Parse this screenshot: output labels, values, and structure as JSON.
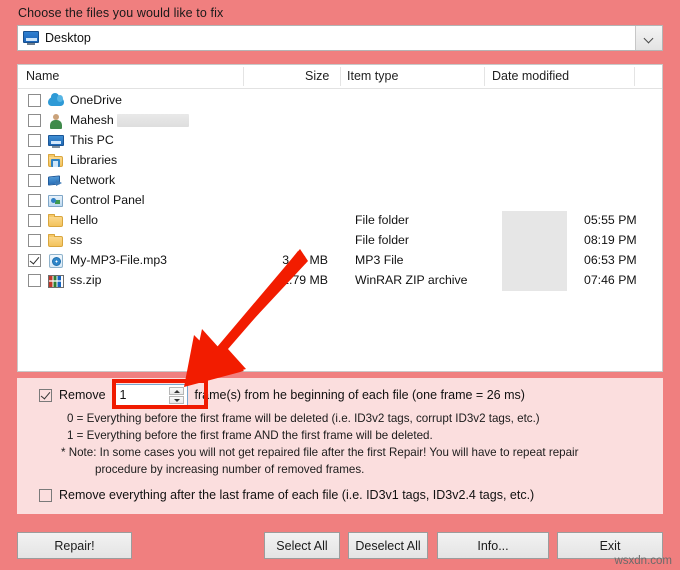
{
  "header": {
    "prompt": "Choose the files you would like to fix"
  },
  "path_combo": {
    "value": "Desktop",
    "icon": "monitor-icon",
    "dropdown_icon": "chevron-down-icon"
  },
  "file_list": {
    "columns": [
      "Name",
      "Size",
      "Item type",
      "Date modified"
    ],
    "rows": [
      {
        "name": "OneDrive",
        "icon": "onedrive-cloud-icon",
        "checked": false,
        "size": "",
        "type": "",
        "date_redacted": false,
        "time": "",
        "name_redacted": false
      },
      {
        "name": "Mahesh",
        "icon": "user-account-icon",
        "checked": false,
        "size": "",
        "type": "",
        "date_redacted": false,
        "time": "",
        "name_redacted": true
      },
      {
        "name": "This PC",
        "icon": "this-pc-icon",
        "checked": false,
        "size": "",
        "type": "",
        "date_redacted": false,
        "time": "",
        "name_redacted": false
      },
      {
        "name": "Libraries",
        "icon": "libraries-folder-icon",
        "checked": false,
        "size": "",
        "type": "",
        "date_redacted": false,
        "time": "",
        "name_redacted": false
      },
      {
        "name": "Network",
        "icon": "network-icon",
        "checked": false,
        "size": "",
        "type": "",
        "date_redacted": false,
        "time": "",
        "name_redacted": false
      },
      {
        "name": "Control Panel",
        "icon": "control-panel-icon",
        "checked": false,
        "size": "",
        "type": "",
        "date_redacted": false,
        "time": "",
        "name_redacted": false
      },
      {
        "name": "Hello",
        "icon": "folder-icon",
        "checked": false,
        "size": "",
        "type": "File folder",
        "date_redacted": true,
        "time": "05:55 PM",
        "name_redacted": false
      },
      {
        "name": "ss",
        "icon": "folder-icon",
        "checked": false,
        "size": "",
        "type": "File folder",
        "date_redacted": true,
        "time": "08:19 PM",
        "name_redacted": false
      },
      {
        "name": "My-MP3-File.mp3",
        "icon": "mp3-file-icon",
        "checked": true,
        "size": "3.62 MB",
        "type": "MP3 File",
        "date_redacted": true,
        "time": "06:53 PM",
        "name_redacted": false
      },
      {
        "name": "ss.zip",
        "icon": "winrar-zip-icon",
        "checked": false,
        "size": "2.79 MB",
        "type": "WinRAR ZIP archive",
        "date_redacted": true,
        "time": "07:46 PM",
        "name_redacted": false
      }
    ]
  },
  "options": {
    "remove_frames_checked": true,
    "remove_frames_prefix": "Remove",
    "frames_value": "1",
    "remove_frames_suffix": "frame(s) from he beginning of each file (one frame = 26 ms)",
    "notes": [
      "0 = Everything before the first frame will be deleted (i.e. ID3v2 tags, corrupt ID3v2 tags, etc.)",
      "1 = Everything before the first frame AND the first frame will be deleted.",
      "* Note: In some cases you will not get repaired file after the first Repair! You will have to repeat repair",
      "procedure by increasing number of removed frames."
    ],
    "remove_last_checked": false,
    "remove_last_label": "Remove everything after the last frame of each file (i.e. ID3v1 tags, ID3v2.4 tags, etc.)"
  },
  "buttons": {
    "repair": "Repair!",
    "select_all": "Select All",
    "deselect_all": "Deselect All",
    "info": "Info...",
    "exit": "Exit"
  },
  "annotation": {
    "arrow_icon": "red-arrow-icon",
    "arrow_color": "#f01a00",
    "highlight_color": "#f01a00"
  },
  "watermark": "wsxdn.com",
  "colors": {
    "background": "#f07f7f",
    "panel": "#fbdede",
    "list_background": "#ffffff"
  }
}
